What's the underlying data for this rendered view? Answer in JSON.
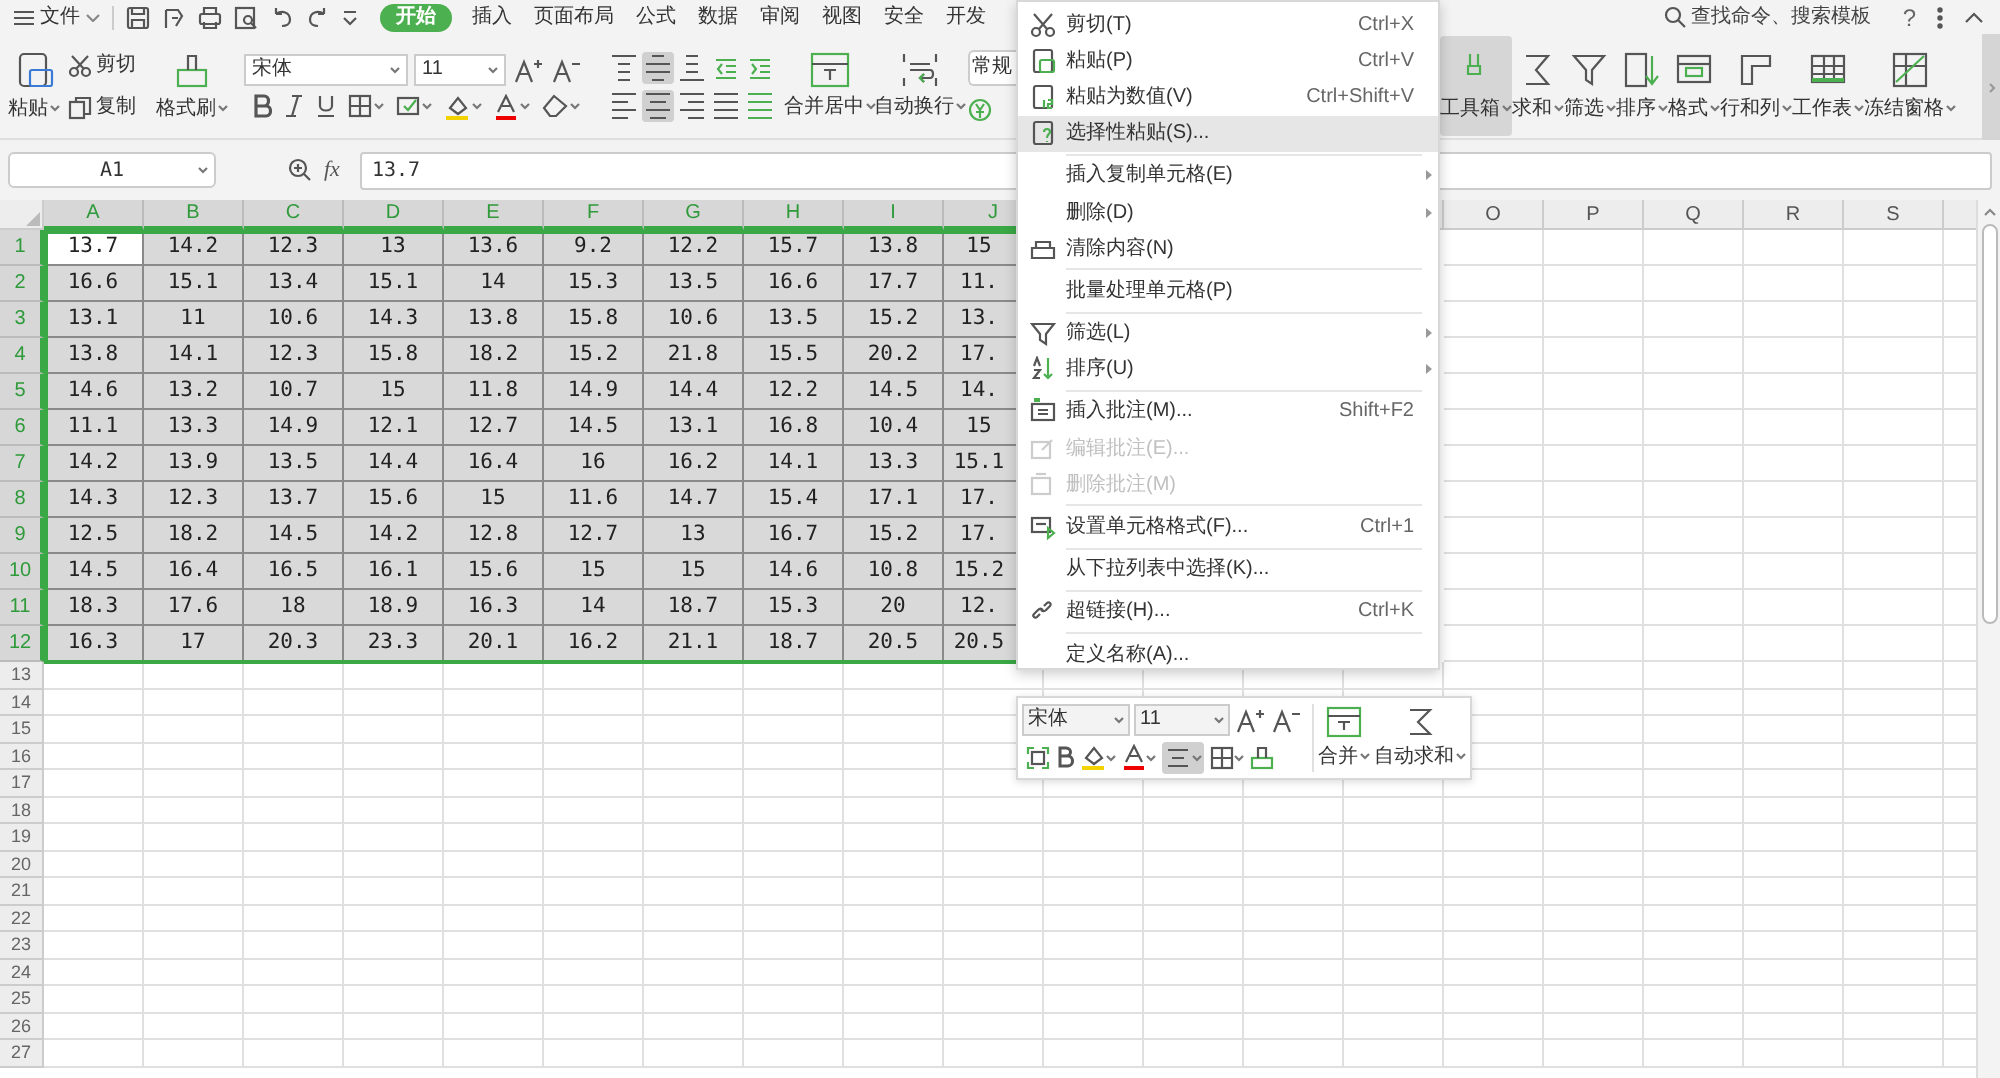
{
  "menu_bar": {
    "file": "文件",
    "tabs": [
      {
        "label": "开始",
        "selected": true
      },
      {
        "label": "插入",
        "selected": false
      },
      {
        "label": "页面布局",
        "selected": false
      },
      {
        "label": "公式",
        "selected": false
      },
      {
        "label": "数据",
        "selected": false
      },
      {
        "label": "审阅",
        "selected": false
      },
      {
        "label": "视图",
        "selected": false
      },
      {
        "label": "安全",
        "selected": false
      },
      {
        "label": "开发",
        "selected": false
      }
    ],
    "search": {
      "placeholder": "查找命令、搜索模板"
    },
    "help": "?"
  },
  "ribbon": {
    "paste": "粘贴",
    "cut": "剪切",
    "copy": "复制",
    "format_painter": "格式刷",
    "font_name": "宋体",
    "font_size": "11",
    "align_pressed": {
      "top": false,
      "middle": true,
      "bottom": false,
      "left": false,
      "center": true,
      "right": false,
      "justify": false,
      "distributed": false
    },
    "merge_center": "合并居中",
    "wrap_text": "自动换行",
    "number_format": "常规",
    "right_tools": [
      {
        "label": "工具箱",
        "hovered": true
      },
      {
        "label": "求和",
        "hovered": false
      },
      {
        "label": "筛选",
        "hovered": false
      },
      {
        "label": "排序",
        "hovered": false
      },
      {
        "label": "格式",
        "hovered": false
      },
      {
        "label": "行和列",
        "hovered": false
      },
      {
        "label": "工作表",
        "hovered": false
      },
      {
        "label": "冻结窗格",
        "hovered": false
      }
    ]
  },
  "formula_bar": {
    "name_box": "A1",
    "fx": "fx",
    "value": "13.7"
  },
  "sheet": {
    "columns_left": [
      {
        "label": "A",
        "selected": true,
        "active": true
      },
      {
        "label": "B",
        "selected": true,
        "active": false
      },
      {
        "label": "C",
        "selected": true,
        "active": false
      },
      {
        "label": "D",
        "selected": true,
        "active": false
      },
      {
        "label": "E",
        "selected": true,
        "active": false
      },
      {
        "label": "F",
        "selected": true,
        "active": false
      },
      {
        "label": "G",
        "selected": true,
        "active": false
      },
      {
        "label": "H",
        "selected": true,
        "active": false
      },
      {
        "label": "I",
        "selected": true,
        "active": false
      },
      {
        "label": "J",
        "selected": true,
        "active": false
      }
    ],
    "columns_right": [
      {
        "label": "O"
      },
      {
        "label": "P"
      },
      {
        "label": "Q"
      },
      {
        "label": "R"
      },
      {
        "label": "S"
      }
    ],
    "rows": [
      {
        "label": "1",
        "selected": true,
        "active": true,
        "cells": [
          "13.7",
          "14.2",
          "12.3",
          "13",
          "13.6",
          "9.2",
          "12.2",
          "15.7",
          "13.8",
          "15"
        ]
      },
      {
        "label": "2",
        "selected": true,
        "active": false,
        "cells": [
          "16.6",
          "15.1",
          "13.4",
          "15.1",
          "14",
          "15.3",
          "13.5",
          "16.6",
          "17.7",
          "11."
        ]
      },
      {
        "label": "3",
        "selected": true,
        "active": false,
        "cells": [
          "13.1",
          "11",
          "10.6",
          "14.3",
          "13.8",
          "15.8",
          "10.6",
          "13.5",
          "15.2",
          "13."
        ]
      },
      {
        "label": "4",
        "selected": true,
        "active": false,
        "cells": [
          "13.8",
          "14.1",
          "12.3",
          "15.8",
          "18.2",
          "15.2",
          "21.8",
          "15.5",
          "20.2",
          "17."
        ]
      },
      {
        "label": "5",
        "selected": true,
        "active": false,
        "cells": [
          "14.6",
          "13.2",
          "10.7",
          "15",
          "11.8",
          "14.9",
          "14.4",
          "12.2",
          "14.5",
          "14."
        ]
      },
      {
        "label": "6",
        "selected": true,
        "active": false,
        "cells": [
          "11.1",
          "13.3",
          "14.9",
          "12.1",
          "12.7",
          "14.5",
          "13.1",
          "16.8",
          "10.4",
          "15"
        ]
      },
      {
        "label": "7",
        "selected": true,
        "active": false,
        "cells": [
          "14.2",
          "13.9",
          "13.5",
          "14.4",
          "16.4",
          "16",
          "16.2",
          "14.1",
          "13.3",
          "15.1"
        ]
      },
      {
        "label": "8",
        "selected": true,
        "active": false,
        "cells": [
          "14.3",
          "12.3",
          "13.7",
          "15.6",
          "15",
          "11.6",
          "14.7",
          "15.4",
          "17.1",
          "17."
        ]
      },
      {
        "label": "9",
        "selected": true,
        "active": false,
        "cells": [
          "12.5",
          "18.2",
          "14.5",
          "14.2",
          "12.8",
          "12.7",
          "13",
          "16.7",
          "15.2",
          "17."
        ]
      },
      {
        "label": "10",
        "selected": true,
        "active": false,
        "cells": [
          "14.5",
          "16.4",
          "16.5",
          "16.1",
          "15.6",
          "15",
          "15",
          "14.6",
          "10.8",
          "15.2"
        ]
      },
      {
        "label": "11",
        "selected": true,
        "active": false,
        "cells": [
          "18.3",
          "17.6",
          "18",
          "18.9",
          "16.3",
          "14",
          "18.7",
          "15.3",
          "20",
          "12."
        ]
      },
      {
        "label": "12",
        "selected": true,
        "active": false,
        "cells": [
          "16.3",
          "17",
          "20.3",
          "23.3",
          "20.1",
          "16.2",
          "21.1",
          "18.7",
          "20.5",
          "20.5"
        ]
      }
    ],
    "empty_rows": [
      "13",
      "14",
      "15",
      "16",
      "17",
      "18",
      "19",
      "20",
      "21",
      "22",
      "23",
      "24",
      "25",
      "26",
      "27"
    ]
  },
  "context_menu": {
    "items": [
      {
        "label": "剪切(T)",
        "shortcut": "Ctrl+X",
        "separator_before": false,
        "submenu": false,
        "disabled": false,
        "selected": false
      },
      {
        "label": "粘贴(P)",
        "shortcut": "Ctrl+V",
        "separator_before": false,
        "submenu": false,
        "disabled": false,
        "selected": false
      },
      {
        "label": "粘贴为数值(V)",
        "shortcut": "Ctrl+Shift+V",
        "separator_before": false,
        "submenu": false,
        "disabled": false,
        "selected": false
      },
      {
        "label": "选择性粘贴(S)...",
        "separator_before": false,
        "submenu": false,
        "disabled": false,
        "selected": true
      },
      {
        "label": "插入复制单元格(E)",
        "separator_before": true,
        "submenu": true,
        "disabled": false,
        "selected": false
      },
      {
        "label": "删除(D)",
        "separator_before": false,
        "submenu": true,
        "disabled": false,
        "selected": false
      },
      {
        "label": "清除内容(N)",
        "separator_before": false,
        "submenu": false,
        "disabled": false,
        "selected": false
      },
      {
        "label": "批量处理单元格(P)",
        "separator_before": true,
        "submenu": false,
        "disabled": false,
        "selected": false
      },
      {
        "label": "筛选(L)",
        "separator_before": true,
        "submenu": true,
        "disabled": false,
        "selected": false
      },
      {
        "label": "排序(U)",
        "separator_before": false,
        "submenu": true,
        "disabled": false,
        "selected": false
      },
      {
        "label": "插入批注(M)...",
        "shortcut": "Shift+F2",
        "separator_before": true,
        "submenu": false,
        "disabled": false,
        "selected": false
      },
      {
        "label": "编辑批注(E)...",
        "separator_before": false,
        "submenu": false,
        "disabled": true,
        "selected": false
      },
      {
        "label": "删除批注(M)",
        "separator_before": false,
        "submenu": false,
        "disabled": true,
        "selected": false
      },
      {
        "label": "设置单元格格式(F)...",
        "shortcut": "Ctrl+1",
        "separator_before": true,
        "submenu": false,
        "disabled": false,
        "selected": false
      },
      {
        "label": "从下拉列表中选择(K)...",
        "separator_before": true,
        "submenu": false,
        "disabled": false,
        "selected": false
      },
      {
        "label": "超链接(H)...",
        "shortcut": "Ctrl+K",
        "separator_before": true,
        "submenu": false,
        "disabled": false,
        "selected": false
      },
      {
        "label": "定义名称(A)...",
        "separator_before": true,
        "submenu": false,
        "disabled": false,
        "selected": false
      }
    ]
  },
  "mini_toolbar": {
    "font_name": "宋体",
    "font_size": "11",
    "align_pressed": true,
    "merge": "合并",
    "autosum": "自动求和"
  }
}
